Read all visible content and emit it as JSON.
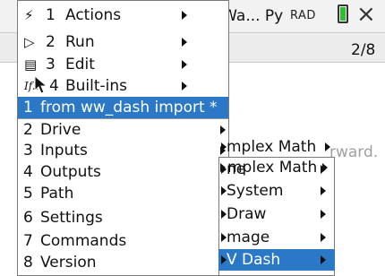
{
  "header": {
    "title": "h Wa... Py",
    "mode": "RAD",
    "page_indicator": "2/8",
    "hint_text": "rward."
  },
  "main_menu": {
    "items": [
      {
        "icon": "lightning-icon",
        "glyph": "⚡",
        "number": "1",
        "label": "Actions"
      },
      {
        "icon": "play-outline-icon",
        "glyph": "▷",
        "number": "2",
        "label": "Run"
      },
      {
        "icon": "edit-icon",
        "glyph": "▤",
        "number": "3",
        "label": "Edit"
      },
      {
        "icon": "if-icon",
        "glyph": "If..",
        "number": "4",
        "label": "Built-ins"
      }
    ],
    "sub_items": [
      {
        "number": "1",
        "label": "from ww_dash import *",
        "selected": true
      },
      {
        "number": "2",
        "label": "Drive"
      },
      {
        "number": "3",
        "label": "Inputs"
      },
      {
        "number": "4",
        "label": "Outputs"
      },
      {
        "number": "5",
        "label": "Path"
      },
      {
        "number": "6",
        "label": "Settings"
      },
      {
        "number": "7",
        "label": "Commands"
      },
      {
        "number": "8",
        "label": "Version"
      }
    ]
  },
  "submenu": {
    "items": [
      {
        "label": "mplex Math"
      },
      {
        "label": "ne"
      },
      {
        "label": "System"
      },
      {
        "label": "Draw"
      },
      {
        "label": "mage"
      },
      {
        "label": "V Dash",
        "selected": true
      }
    ]
  },
  "colors": {
    "selection": "#2a78c6",
    "battery": "#2fbe32",
    "hint": "#a0a0a0"
  }
}
